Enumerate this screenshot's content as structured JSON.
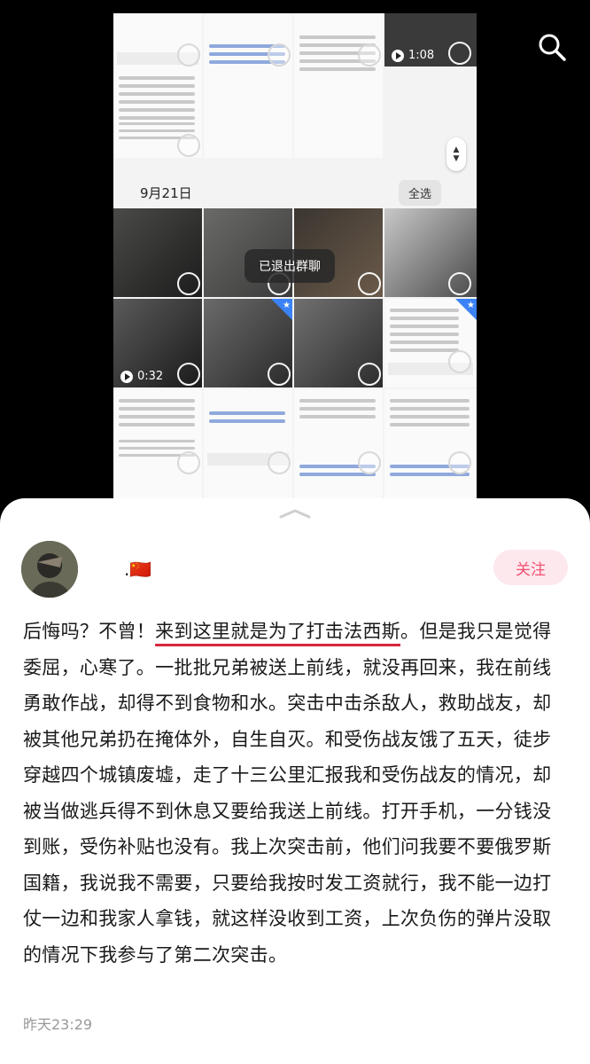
{
  "header": {
    "search_icon": "search-icon"
  },
  "gallery": {
    "date_label": "9月21日",
    "select_all": "全选",
    "toast": "已退出群聊",
    "video_durations": [
      "1:08",
      "0:32"
    ]
  },
  "post": {
    "username": ".",
    "flag": "🇨🇳",
    "follow_label": "关注",
    "text_before": "后悔吗？不曾！",
    "text_highlight": "来到这里就是为了打击法西斯",
    "text_after": "。但是我只是觉得委屈，心寒了。一批批兄弟被送上前线，就没再回来，我在前线勇敢作战，却得不到食物和水。突击中击杀敌人，救助战友，却被其他兄弟扔在掩体外，自生自灭。和受伤战友饿了五天，徒步穿越四个城镇废墟，走了十三公里汇报我和受伤战友的情况，却被当做逃兵得不到休息又要给我送上前线。打开手机，一分钱没到账，受伤补贴也没有。我上次突击前，他们问我要不要俄罗斯国籍，我说我不需要，只要给我按时发工资就行，我不能一边打仗一边和我家人拿钱，就这样没收到工资，上次负伤的弹片没取的情况下我参与了第二次突击。",
    "timestamp": "昨天23:29"
  },
  "colors": {
    "accent": "#f0506e",
    "follow_bg": "#fde8ee",
    "underline": "#d7263d"
  }
}
